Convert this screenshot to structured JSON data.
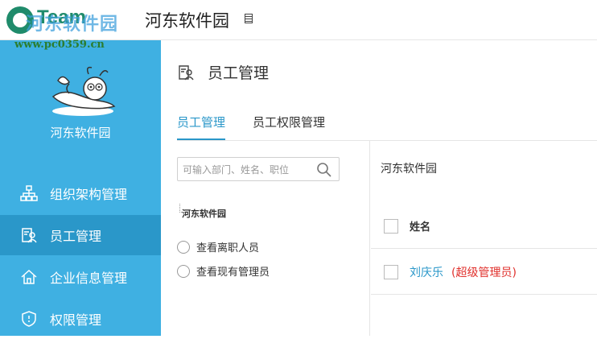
{
  "header": {
    "brand": "Team",
    "watermark_cn": "河东软件园",
    "watermark_url": "www.pc0359.cn",
    "org_title": "河东软件园"
  },
  "sidebar": {
    "org_name": "河东软件园",
    "items": [
      {
        "label": "组织架构管理",
        "icon": "org-chart-icon"
      },
      {
        "label": "员工管理",
        "icon": "employee-card-icon",
        "active": true
      },
      {
        "label": "企业信息管理",
        "icon": "home-icon"
      },
      {
        "label": "权限管理",
        "icon": "shield-icon"
      }
    ]
  },
  "main": {
    "page_title": "员工管理",
    "tabs": [
      {
        "label": "员工管理",
        "active": true
      },
      {
        "label": "员工权限管理",
        "active": false
      }
    ],
    "search": {
      "placeholder": "可输入部门、姓名、职位",
      "value": ""
    },
    "tree_root": "河东软件园",
    "filters": [
      {
        "label": "查看离职人员"
      },
      {
        "label": "查看现有管理员"
      }
    ],
    "right": {
      "org_label": "河东软件园",
      "column_name": "姓名",
      "rows": [
        {
          "name": "刘庆乐",
          "role": "(超级管理员)"
        }
      ]
    }
  },
  "colors": {
    "sidebar_bg": "#3fb0e2",
    "sidebar_active": "#2a97c9",
    "accent": "#2a97c9",
    "admin_red": "#e0302c"
  }
}
